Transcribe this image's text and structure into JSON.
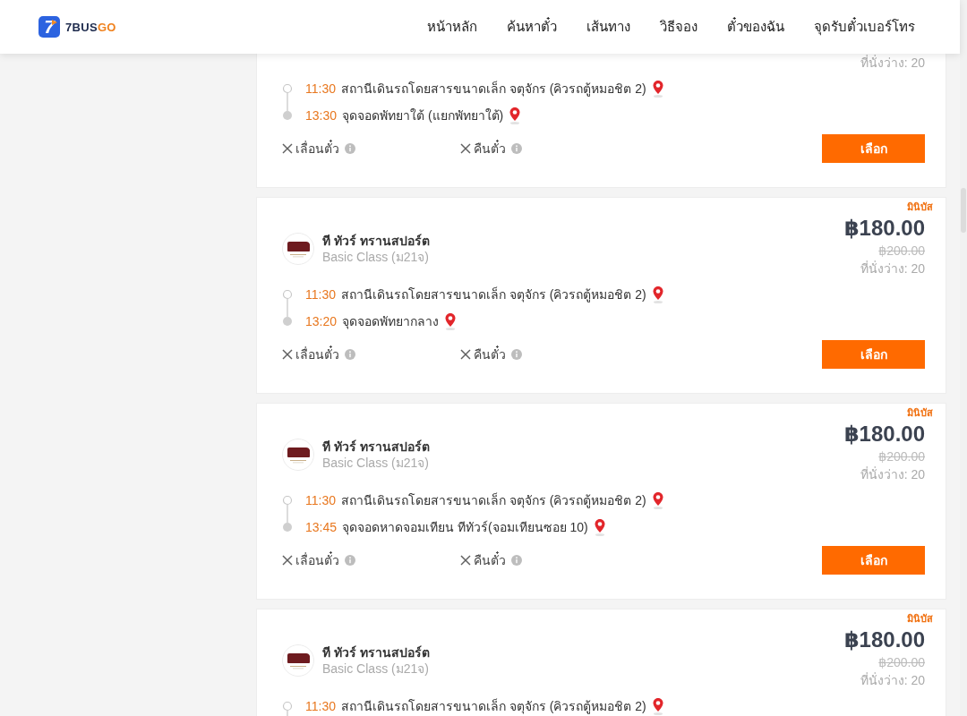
{
  "header": {
    "logo": {
      "mark": "7",
      "name": "7BUS",
      "name_accent": "GO"
    },
    "nav": [
      "หน้าหลัก",
      "ค้นหาตั๋ว",
      "เส้นทาง",
      "วิธีจอง",
      "ตั๋วของฉัน",
      "จุดรับตั๋วเบอร์โทร"
    ]
  },
  "trips": [
    {
      "seats": "ที่นั่งว่าง: 20",
      "stops": [
        {
          "kind": "departure",
          "time": "11:30",
          "place": "สถานีเดินรถโดยสารขนาดเล็ก จตุจักร (คิวรถตู้หมอชิต 2)"
        },
        {
          "kind": "arrival",
          "time": "13:30",
          "place": "จุดจอดพัทยาใต้ (แยกพัทยาใต้)"
        }
      ],
      "options": [
        {
          "label": "เลื่อนตั๋ว",
          "allowed": false
        },
        {
          "label": "คืนตั๋ว",
          "allowed": false
        }
      ],
      "button": "เลือก"
    },
    {
      "vehicle_type": "มินิบัส",
      "price": "฿180.00",
      "old_price": "฿200.00",
      "seats": "ที่นั่งว่าง: 20",
      "operator": {
        "name": "ที ทัวร์ ทรานสปอร์ต",
        "class": "Basic Class (ม21จ)"
      },
      "stops": [
        {
          "kind": "departure",
          "time": "11:30",
          "place": "สถานีเดินรถโดยสารขนาดเล็ก จตุจักร (คิวรถตู้หมอชิต 2)"
        },
        {
          "kind": "arrival",
          "time": "13:20",
          "place": "จุดจอดพัทยากลาง"
        }
      ],
      "options": [
        {
          "label": "เลื่อนตั๋ว",
          "allowed": false
        },
        {
          "label": "คืนตั๋ว",
          "allowed": false
        }
      ],
      "button": "เลือก"
    },
    {
      "vehicle_type": "มินิบัส",
      "price": "฿180.00",
      "old_price": "฿200.00",
      "seats": "ที่นั่งว่าง: 20",
      "operator": {
        "name": "ที ทัวร์ ทรานสปอร์ต",
        "class": "Basic Class (ม21จ)"
      },
      "stops": [
        {
          "kind": "departure",
          "time": "11:30",
          "place": "สถานีเดินรถโดยสารขนาดเล็ก จตุจักร (คิวรถตู้หมอชิต 2)"
        },
        {
          "kind": "arrival",
          "time": "13:45",
          "place": "จุดจอดหาดจอมเทียน ทีทัวร์(จอมเทียนซอย 10)"
        }
      ],
      "options": [
        {
          "label": "เลื่อนตั๋ว",
          "allowed": false
        },
        {
          "label": "คืนตั๋ว",
          "allowed": false
        }
      ],
      "button": "เลือก"
    },
    {
      "vehicle_type": "มินิบัส",
      "price": "฿180.00",
      "old_price": "฿200.00",
      "seats": "ที่นั่งว่าง: 20",
      "operator": {
        "name": "ที ทัวร์ ทรานสปอร์ต",
        "class": "Basic Class (ม21จ)"
      },
      "stops": [
        {
          "kind": "departure",
          "time": "11:30",
          "place": "สถานีเดินรถโดยสารขนาดเล็ก จตุจักร (คิวรถตู้หมอชิต 2)"
        }
      ]
    }
  ]
}
